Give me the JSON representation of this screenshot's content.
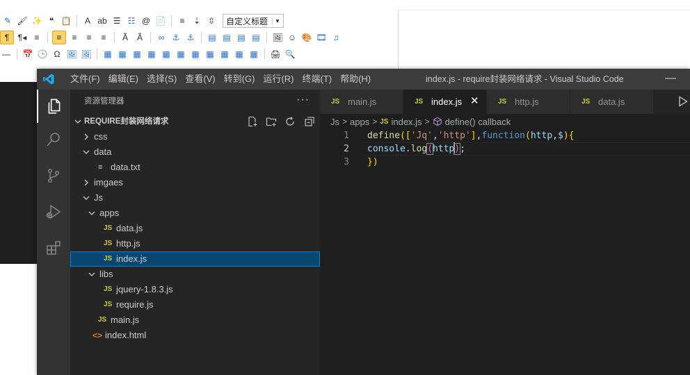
{
  "rich_text_editor": {
    "heading_select": "自定义标题",
    "row1": [
      "✎",
      "🖌",
      "✨",
      "❝",
      "📋",
      "A",
      "ab",
      "☰",
      "☷",
      "@",
      "📄",
      "≡",
      "⇣",
      "⇳"
    ],
    "row2": [
      "¶",
      "¶◂",
      "≡",
      "≡",
      "≡",
      "≡",
      "≡",
      "Ã",
      "Ã",
      "∞",
      "⚓",
      "⚓",
      "▤",
      "▤",
      "▤",
      "▤",
      "🖼",
      "☺",
      "🎨",
      "🎞",
      "♫"
    ],
    "row3": [
      "—",
      "📅",
      "🕒",
      "Ω",
      "🖼",
      "🖼",
      "▦",
      "▦",
      "▦",
      "▦",
      "▦",
      "▦",
      "▦",
      "▦",
      "▦",
      "▦",
      "▦",
      "🖨",
      "🔍"
    ]
  },
  "titlebar": {
    "menu": [
      "文件(F)",
      "编辑(E)",
      "选择(S)",
      "查看(V)",
      "转到(G)",
      "运行(R)",
      "终端(T)",
      "帮助(H)"
    ],
    "title": "index.js - require封装网络请求 - Visual Studio Code",
    "minimize": "—"
  },
  "activity_bar": [
    "explorer-icon",
    "search-icon",
    "source-control-icon",
    "run-debug-icon",
    "extensions-icon"
  ],
  "sidebar": {
    "header": "资源管理器",
    "more": "···",
    "project": "REQUIRE封装网络请求",
    "tree": [
      {
        "label": "css",
        "type": "folder",
        "depth": 1,
        "expanded": false
      },
      {
        "label": "data",
        "type": "folder",
        "depth": 1,
        "expanded": true
      },
      {
        "label": "data.txt",
        "type": "txt",
        "depth": 2
      },
      {
        "label": "imgaes",
        "type": "folder",
        "depth": 1,
        "expanded": false
      },
      {
        "label": "Js",
        "type": "folder",
        "depth": 1,
        "expanded": true
      },
      {
        "label": "apps",
        "type": "folder",
        "depth": 2,
        "expanded": true
      },
      {
        "label": "data.js",
        "type": "js",
        "depth": 3
      },
      {
        "label": "http.js",
        "type": "js",
        "depth": 3
      },
      {
        "label": "index.js",
        "type": "js",
        "depth": 3,
        "selected": true
      },
      {
        "label": "libs",
        "type": "folder",
        "depth": 2,
        "expanded": true
      },
      {
        "label": "jquery-1.8.3.js",
        "type": "js",
        "depth": 3
      },
      {
        "label": "require.js",
        "type": "js",
        "depth": 3
      },
      {
        "label": "main.js",
        "type": "js",
        "depth": 2
      },
      {
        "label": "index.html",
        "type": "html",
        "depth": 1
      }
    ]
  },
  "tabs": [
    {
      "icon": "JS",
      "label": "main.js",
      "active": false
    },
    {
      "icon": "JS",
      "label": "index.js",
      "active": true,
      "close": "✕"
    },
    {
      "icon": "JS",
      "label": "http.js",
      "active": false
    },
    {
      "icon": "JS",
      "label": "data.js",
      "active": false
    }
  ],
  "breadcrumb": {
    "parts": [
      "Js",
      "apps"
    ],
    "file_icon": "JS",
    "file": "index.js",
    "symbol": "define() callback",
    "separator": ">"
  },
  "editor": {
    "line_numbers": [
      "1",
      "2",
      "3"
    ],
    "current_line": 2
  },
  "colors": {
    "titlebar": "#3c3c3c",
    "activity_bar": "#333333",
    "sidebar": "#252526",
    "editor": "#1e1e1e",
    "selection": "#094771",
    "js_icon": "#cbcb41"
  }
}
